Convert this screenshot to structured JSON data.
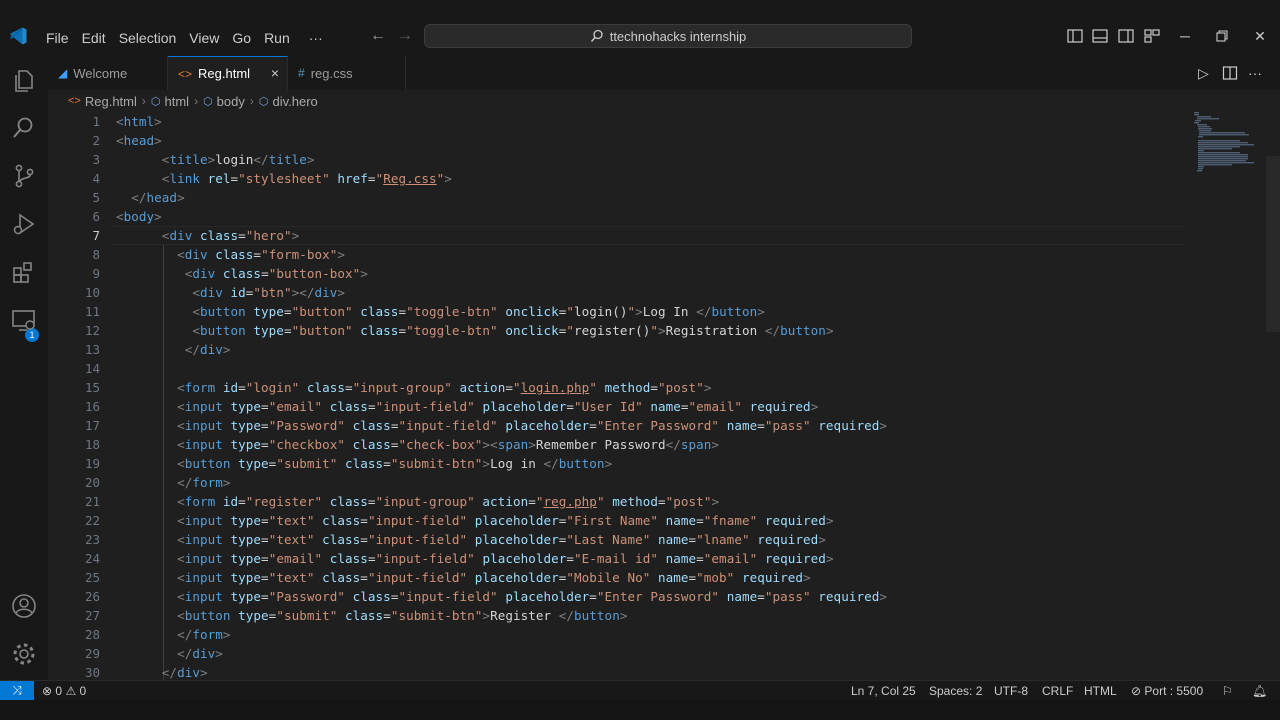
{
  "menu": [
    "File",
    "Edit",
    "Selection",
    "View",
    "Go",
    "Run",
    "···"
  ],
  "command_center": {
    "text": "ttechnohacks internship"
  },
  "tabs": [
    {
      "label": "Welcome",
      "icon": "vscode-icon"
    },
    {
      "label": "Reg.html",
      "icon": "html-file-icon",
      "active": true,
      "close": "×"
    },
    {
      "label": "reg.css",
      "icon": "css-file-icon"
    }
  ],
  "breadcrumb": [
    "Reg.html",
    "html",
    "body",
    "div.hero"
  ],
  "activity_badge": "1",
  "code": {
    "line_numbers": [
      "1",
      "2",
      "3",
      "4",
      "5",
      "6",
      "7",
      "8",
      "9",
      "10",
      "11",
      "12",
      "13",
      "14",
      "15",
      "16",
      "17",
      "18",
      "19",
      "20",
      "21",
      "22",
      "23",
      "24",
      "25",
      "26",
      "27",
      "28",
      "29",
      "30"
    ],
    "current_line": "7"
  },
  "status": {
    "errors": "0",
    "warnings": "0",
    "position": "Ln 7, Col 25",
    "spaces": "Spaces: 2",
    "encoding": "UTF-8",
    "eol": "CRLF",
    "language": "HTML",
    "port": "Port : 5500"
  },
  "colors": {
    "accent": "#0078d4",
    "tag": "#569cd6",
    "attr": "#9cdcfe",
    "string": "#ce9178",
    "text": "#d4d4d4"
  }
}
